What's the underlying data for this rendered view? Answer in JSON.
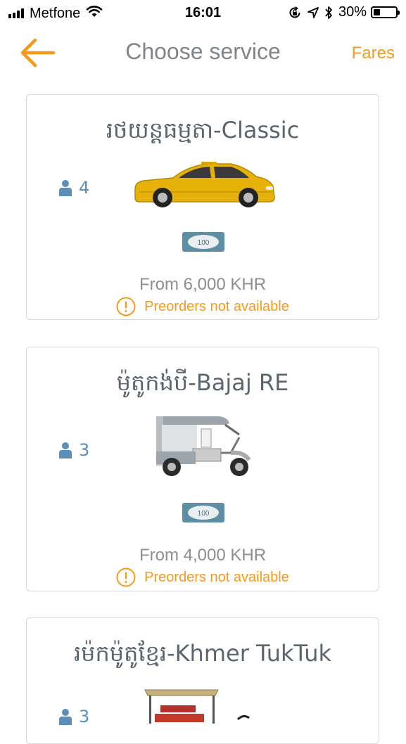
{
  "status_bar": {
    "carrier": "Metfone",
    "time": "16:01",
    "battery_percent": "30%",
    "battery_level": 0.3,
    "icons": [
      "signal-icon",
      "wifi-icon",
      "rotation-lock-icon",
      "location-icon",
      "bluetooth-icon",
      "battery-icon"
    ]
  },
  "header": {
    "title": "Choose service",
    "fares_label": "Fares",
    "back_icon": "arrow-left-icon"
  },
  "colors": {
    "accent": "#f59a1b",
    "capacity_blue": "#5b8fb8",
    "title_gray": "#5b6570"
  },
  "services": [
    {
      "name": "រថយន្តធម្មតា-Classic",
      "capacity": "4",
      "vehicle_icon": "car-icon",
      "payment_icon": "cash-icon",
      "cash_note": "100",
      "fare": "From 6,000 KHR",
      "preorder": "Preorders not available"
    },
    {
      "name": "ម៉ូតូកង់បី-Bajaj RE",
      "capacity": "3",
      "vehicle_icon": "rickshaw-icon",
      "payment_icon": "cash-icon",
      "cash_note": "100",
      "fare": "From 4,000 KHR",
      "preorder": "Preorders not available"
    },
    {
      "name": "រម៉កម៉ូតូខ្មែរ-Khmer TukTuk",
      "capacity": "3",
      "vehicle_icon": "tuktuk-icon"
    }
  ]
}
